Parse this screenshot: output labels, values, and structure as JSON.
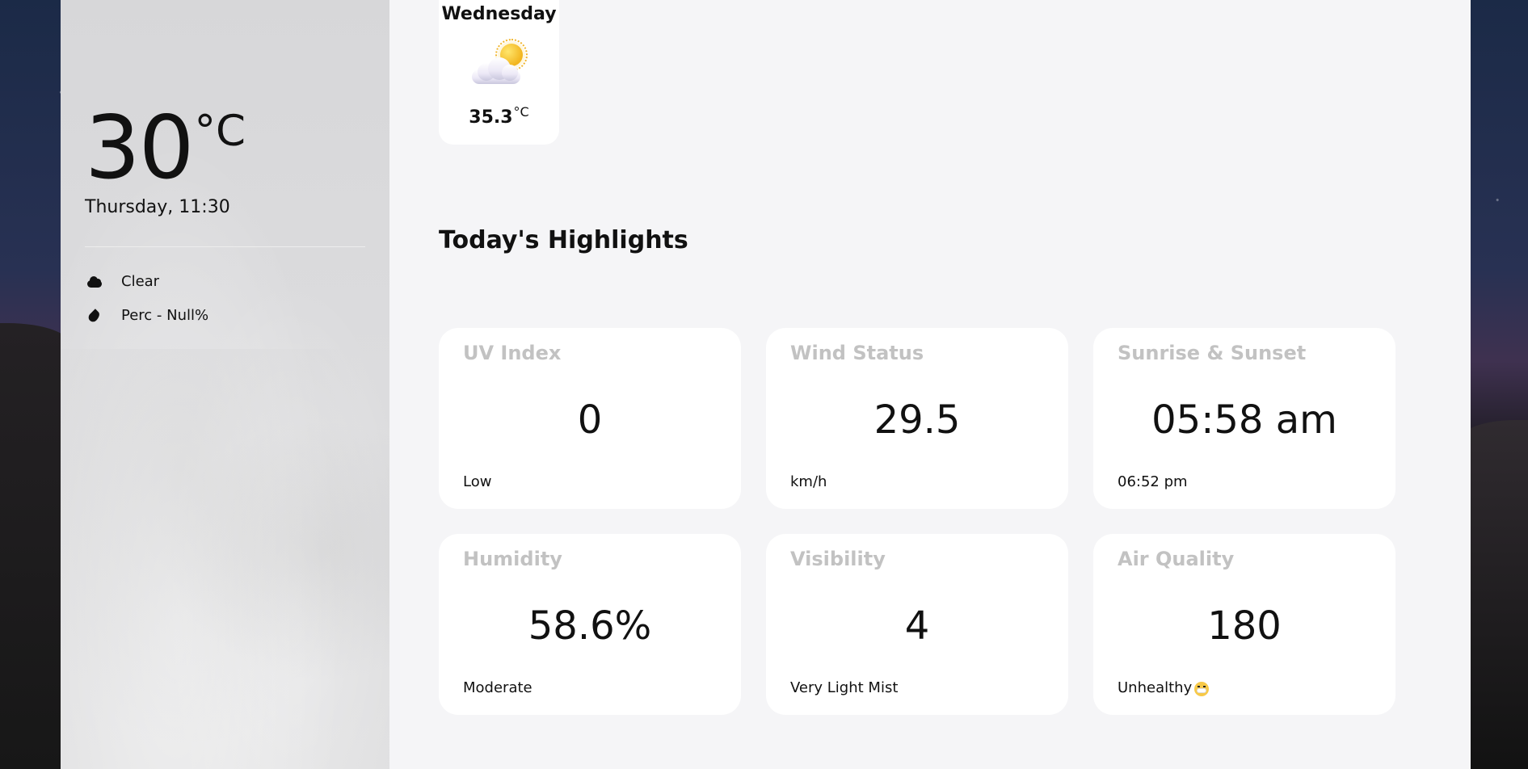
{
  "sidebar": {
    "temperature": {
      "value": "30",
      "unit": "°C"
    },
    "day_time": "Thursday, 11:30",
    "conditions": [
      {
        "icon": "cloud-icon",
        "label": "Clear"
      },
      {
        "icon": "droplet-icon",
        "label": "Perc - Null%"
      }
    ]
  },
  "forecast": {
    "day": "Wednesday",
    "icon": "partly-sunny-icon",
    "temperature": "35.3",
    "unit": "°C"
  },
  "highlights": {
    "title": "Today's Highlights",
    "cards": [
      {
        "title": "UV Index",
        "value": "0",
        "note": "Low"
      },
      {
        "title": "Wind Status",
        "value": "29.5",
        "note": "km/h"
      },
      {
        "title": "Sunrise & Sunset",
        "value": "05:58 am",
        "note": "06:52 pm"
      },
      {
        "title": "Humidity",
        "value": "58.6%",
        "note": "Moderate"
      },
      {
        "title": "Visibility",
        "value": "4",
        "note": "Very Light Mist"
      },
      {
        "title": "Air Quality",
        "value": "180",
        "note": "Unhealthy",
        "icon": "mask-face-icon"
      }
    ]
  }
}
